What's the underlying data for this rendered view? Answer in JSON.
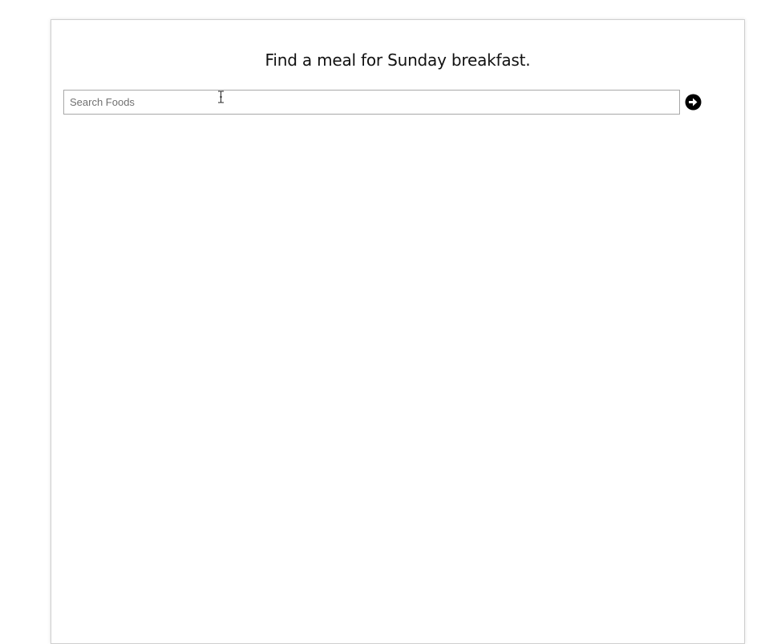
{
  "modal": {
    "title": "Find a meal for Sunday breakfast."
  },
  "search": {
    "placeholder": "Search Foods",
    "value": "",
    "submit_icon": "arrow-circle-right-icon"
  },
  "cursor": {
    "type": "text-cursor-icon"
  }
}
